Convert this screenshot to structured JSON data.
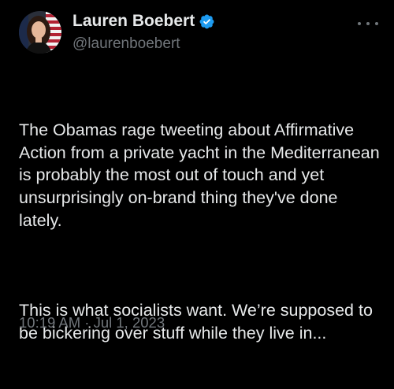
{
  "author": {
    "display_name": "Lauren Boebert",
    "handle": "@laurenboebert",
    "verified_icon": "verified-badge-icon",
    "verified_color": "#1d9bf0"
  },
  "post": {
    "paragraphs": [
      "The Obamas rage tweeting about Affirmative Action from a private yacht in the Mediterranean is probably the most out of touch and yet unsurprisingly on-brand thing they've done lately.",
      "This is what socialists want. We’re supposed to be bickering over stuff while they live in..."
    ],
    "timestamp": "10:19 AM · Jul 1, 2023"
  },
  "menu": {
    "icon": "more-options-icon"
  },
  "colors": {
    "background": "#000000",
    "primary_text": "#e7e9ea",
    "secondary_text": "#71767b"
  }
}
